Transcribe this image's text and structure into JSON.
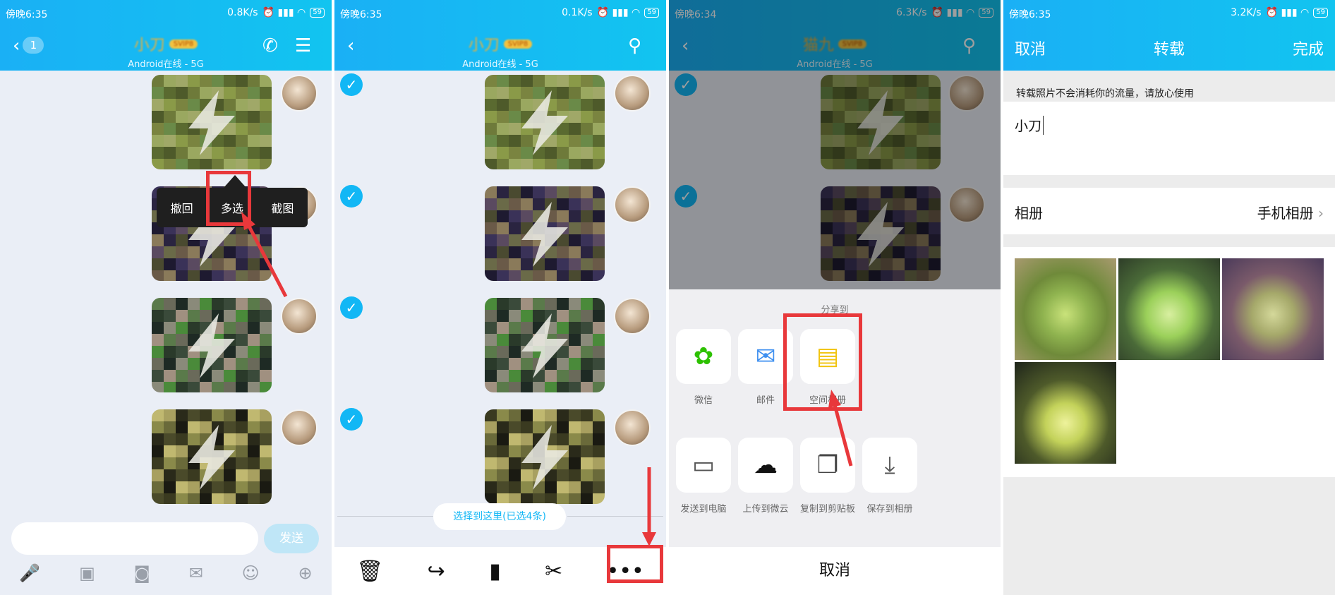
{
  "status_bars": [
    {
      "time": "傍晚6:35",
      "speed": "0.8K/s",
      "battery": "59"
    },
    {
      "time": "傍晚6:35",
      "speed": "0.1K/s",
      "battery": "59"
    },
    {
      "time": "傍晚6:34",
      "speed": "6.3K/s",
      "battery": "59"
    },
    {
      "time": "傍晚6:35",
      "speed": "3.2K/s",
      "battery": "59"
    }
  ],
  "chat": {
    "contact_name": "小刀",
    "contact_name_p3": "猫九",
    "vip_badge": "SVIP8",
    "online_status": "Android在线 - 5G",
    "unread_count": "1"
  },
  "context_menu": {
    "recall": "撤回",
    "multiselect": "多选",
    "screenshot": "截图"
  },
  "input_bar": {
    "send_label": "发送"
  },
  "multiselect": {
    "select_here_label": "选择到这里(已选4条)"
  },
  "share_sheet": {
    "title": "分享到",
    "row1": [
      "微信",
      "邮件",
      "空间相册"
    ],
    "row2": [
      "发送到电脑",
      "上传到微云",
      "复制到剪贴板",
      "保存到相册"
    ],
    "cancel_label": "取消"
  },
  "forward_page": {
    "cancel_label": "取消",
    "title": "转载",
    "done_label": "完成",
    "notice": "转载照片不会消耗你的流量，请放心使用",
    "input_value": "小刀",
    "album_label": "相册",
    "album_value": "手机相册"
  },
  "colors": {
    "accent": "#12b7f5",
    "highlight": "#e8383b",
    "header": "#1ab0f5"
  }
}
